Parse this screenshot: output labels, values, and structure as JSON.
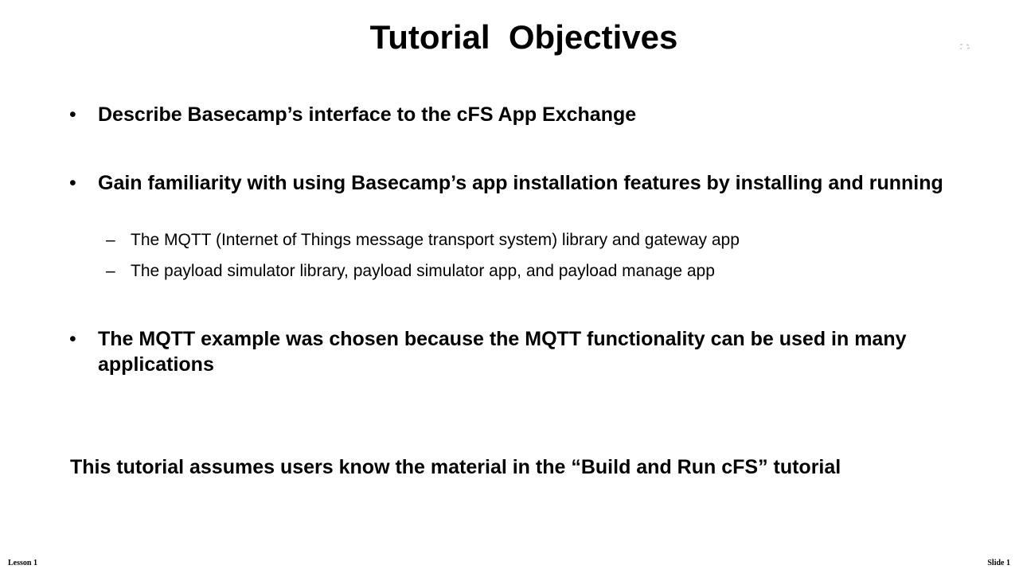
{
  "slide": {
    "title": "Tutorial  Objectives",
    "bullet_glyph": "•",
    "sub_glyph": "–",
    "bullets": [
      {
        "text": "Describe Basecamp’s interface to the cFS App Exchange"
      },
      {
        "text": "Gain familiarity with using Basecamp’s app installation features by installing and running",
        "subitems": [
          "The MQTT (Internet of Things message transport system) library and gateway app",
          "The payload simulator library, payload simulator app, and payload manage app"
        ]
      },
      {
        "text": "The MQTT example was chosen because the MQTT functionality can be used in many applications"
      }
    ],
    "note": "This tutorial assumes users know the material in the “Build and Run cFS” tutorial"
  },
  "footer": {
    "left": "Lesson 1",
    "right": "Slide 1"
  }
}
